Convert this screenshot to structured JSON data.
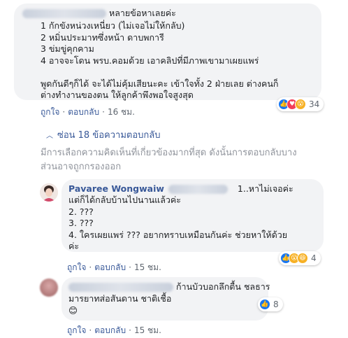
{
  "comment1": {
    "lines": [
      "หลายข้อหาเลยค่ะ",
      "1 กักขังหน่วงเหนี่ยว (ไม่เจอไม่ให้กลับ)",
      "2 หมิ่นประมาทซึ่งหน้า ดาบพการี",
      "3 ข่มขู่คุกคาม",
      "4 อาจจะโดน พรบ.คอมด้วย เอาคลิปที่มีภาพเขามาเผยแพร่",
      "",
      "พูดกันดีๆก็ได้ จะได้ไม่คุ้มเสียนะคะ เข้าใจทั้ง 2 ฝ่ายเลย ต่างคนก็",
      "ต่างทำงานของตน ให้ลูกค้าพึงพอใจสูงสุด"
    ],
    "like": "ถูกใจ",
    "reply": "ตอบกลับ",
    "time": "16 ชม.",
    "reaction_count": "34"
  },
  "replies_toggle": "ซ่อน 18 ข้อความตอบกลับ",
  "notice_lines": [
    "มีการเลือกความคิดเห็นที่เกี่ยวข้องมากที่สุด ดังนั้นการตอบกลับบาง",
    "ส่วนอาจถูกกรองออก"
  ],
  "reply1": {
    "author": "Pavaree Wongwaiw",
    "lines": [
      "1..หาไม่เจอค่ะ",
      "แต่ก็ได้กลับบ้านไปนานแล้วค่ะ",
      "2. ???",
      "3. ???",
      "4. ใครเผยแพร่ ??? อยากทราบเหมือนกันค่ะ ช่วยหาให้ด้วย",
      "ค่ะ"
    ],
    "like": "ถูกใจ",
    "reply": "ตอบกลับ",
    "time": "15 ชม.",
    "reaction_count": "4"
  },
  "reply2": {
    "lines": [
      "ก้านบัวบอกลึกตื้น ชลธาร",
      "มารยาทส่อสันดาน ชาติเชื้อ",
      "😊"
    ],
    "like": "ถูกใจ",
    "reply": "ตอบกลับ",
    "time": "15 ชม.",
    "reaction_count": "8"
  },
  "colors": {
    "link": "#385898",
    "bubble": "#f2f3f5",
    "like": "#1877f2",
    "love": "#f33e58",
    "wow": "#f7b125"
  }
}
